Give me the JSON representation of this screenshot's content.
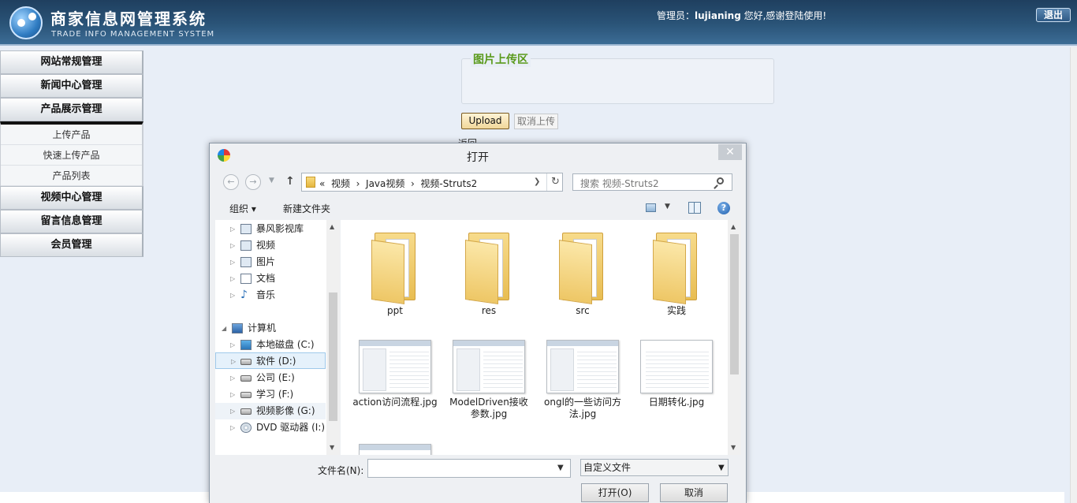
{
  "header": {
    "title": "商家信息网管理系统",
    "subtitle": "TRADE INFO MANAGEMENT SYSTEM",
    "admin_label": "管理员：",
    "admin_name": "lujianing",
    "greeting": " 您好,感谢登陆使用!",
    "logout_label": "退出"
  },
  "sidebar": {
    "menus": [
      {
        "label": "网站常规管理"
      },
      {
        "label": "新闻中心管理"
      },
      {
        "label": "产品展示管理"
      },
      {
        "label": "视频中心管理"
      },
      {
        "label": "留言信息管理"
      },
      {
        "label": "会员管理"
      }
    ],
    "submenu": [
      {
        "label": "上传产品"
      },
      {
        "label": "快速上传产品"
      },
      {
        "label": "产品列表"
      }
    ]
  },
  "upload": {
    "legend": "图片上传区",
    "upload_button": "Upload",
    "cancel_button": "取消上传",
    "return_link": "返回"
  },
  "dialog": {
    "title": "打开",
    "close_symbol": "✕",
    "address": "«  视频  ›  Java视频  ›  视频-Struts2",
    "search_placeholder": "搜索 视频-Struts2",
    "organize_label": "组织 ▾",
    "new_folder_label": "新建文件夹",
    "help_symbol": "?",
    "tree": [
      {
        "label": "暴风影视库",
        "icon": "video-library-icon"
      },
      {
        "label": "视频",
        "icon": "video-icon"
      },
      {
        "label": "图片",
        "icon": "pictures-icon"
      },
      {
        "label": "文档",
        "icon": "documents-icon"
      },
      {
        "label": "音乐",
        "icon": "music-icon"
      },
      {
        "label": "计算机",
        "icon": "computer-icon"
      },
      {
        "label": "本地磁盘 (C:)",
        "icon": "local-disk-icon"
      },
      {
        "label": "软件 (D:)",
        "icon": "drive-icon"
      },
      {
        "label": "公司 (E:)",
        "icon": "drive-icon"
      },
      {
        "label": "学习 (F:)",
        "icon": "drive-icon"
      },
      {
        "label": "视频影像 (G:)",
        "icon": "drive-icon"
      },
      {
        "label": "DVD 驱动器 (I:)",
        "icon": "dvd-icon"
      }
    ],
    "files": [
      {
        "name": "ppt",
        "type": "folder"
      },
      {
        "name": "res",
        "type": "folder"
      },
      {
        "name": "src",
        "type": "folder"
      },
      {
        "name": "实践",
        "type": "folder"
      },
      {
        "name": "action访问流程.jpg",
        "type": "image"
      },
      {
        "name": "ModelDriven接收参数.jpg",
        "type": "image"
      },
      {
        "name": "ongl的一些访问方法.jpg",
        "type": "image"
      },
      {
        "name": "日期转化.jpg",
        "type": "image"
      }
    ],
    "filename_label": "文件名(N):",
    "filename_value": "",
    "filter_value": "自定义文件",
    "open_button": "打开(O)",
    "cancel_button": "取消"
  }
}
